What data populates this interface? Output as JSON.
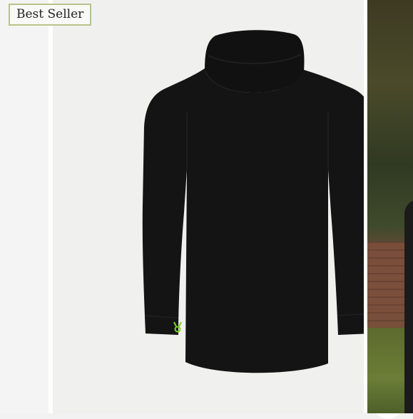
{
  "badge": {
    "label": "Best Seller",
    "border_color": "#b8c48a"
  },
  "product": {
    "garment_color": "#141414",
    "logo_color": "#7ed321"
  },
  "zoom": {
    "icon": "magnifier-icon"
  }
}
